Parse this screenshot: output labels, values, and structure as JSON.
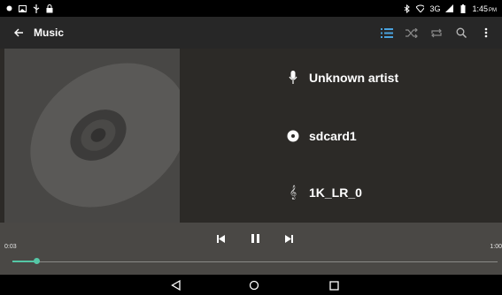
{
  "status_bar": {
    "left_icons": [
      "notification-dot-icon",
      "image-icon",
      "usb-icon",
      "lock-icon"
    ],
    "right_icons": [
      "bluetooth-icon",
      "wifi-icon",
      "signal-icon",
      "battery-icon"
    ],
    "network": "3G",
    "time": "1:45",
    "ampm": "PM"
  },
  "action_bar": {
    "title": "Music",
    "actions": [
      "list-icon",
      "shuffle-icon",
      "repeat-icon",
      "search-icon",
      "more-vert-icon"
    ],
    "active_color": "#4aa3df"
  },
  "track": {
    "artist": "Unknown artist",
    "album": "sdcard1",
    "title": "1K_LR_0"
  },
  "player": {
    "elapsed": "0:03",
    "duration": "1:00",
    "progress": 0.05,
    "accent": "#55c7a6"
  },
  "nav_bar": {
    "buttons": [
      "back-icon",
      "home-icon",
      "recents-icon"
    ]
  }
}
